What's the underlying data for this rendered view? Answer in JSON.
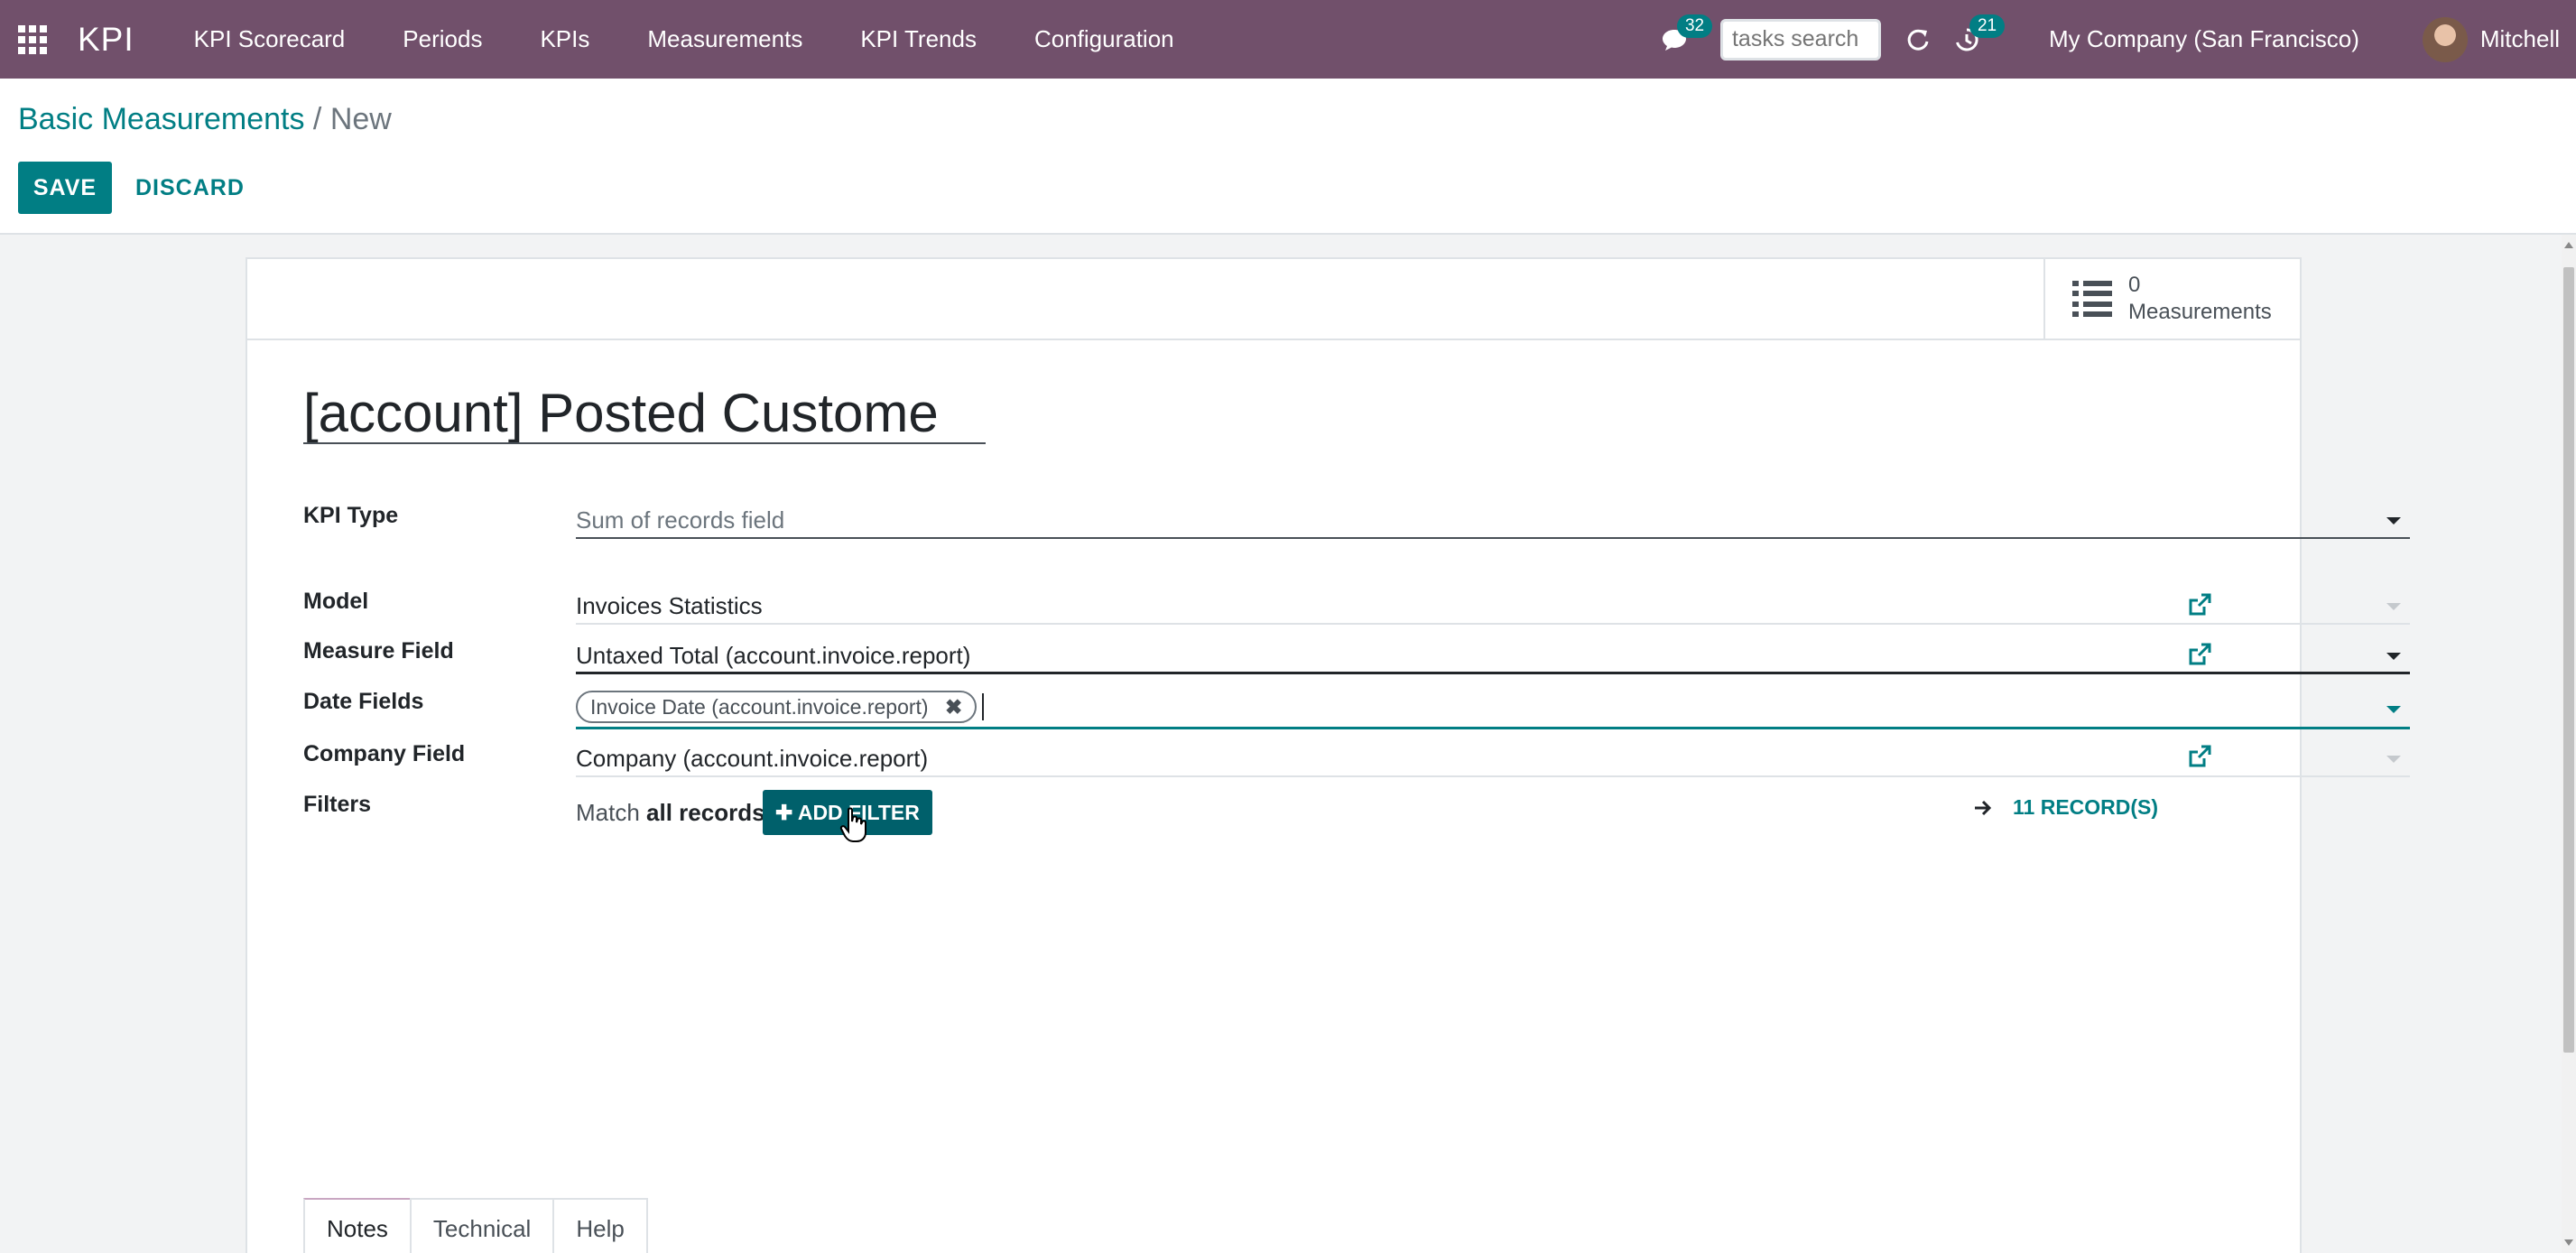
{
  "navbar": {
    "brand": "KPI",
    "menu": [
      "KPI Scorecard",
      "Periods",
      "KPIs",
      "Measurements",
      "KPI Trends",
      "Configuration"
    ],
    "messages_count": "32",
    "search_placeholder": "tasks search",
    "activities_count": "21",
    "company": "My Company (San Francisco)",
    "user": "Mitchell",
    "icons": [
      "apps-grid-icon",
      "chat-icon",
      "refresh-icon",
      "clock-icon",
      "avatar"
    ]
  },
  "breadcrumb": {
    "parent": "Basic Measurements",
    "separator": "/",
    "current": "New"
  },
  "actions": {
    "save": "SAVE",
    "discard": "DISCARD"
  },
  "stat_button": {
    "count": "0",
    "label": "Measurements"
  },
  "form": {
    "title": "[account] Posted Custome",
    "fields": {
      "kpi_type": {
        "label": "KPI Type",
        "value": "Sum of records field"
      },
      "model": {
        "label": "Model",
        "value": "Invoices Statistics"
      },
      "measure_field": {
        "label": "Measure Field",
        "value": "Untaxed Total (account.invoice.report)"
      },
      "date_fields": {
        "label": "Date Fields",
        "tags": [
          "Invoice Date (account.invoice.report)"
        ]
      },
      "company_field": {
        "label": "Company Field",
        "value": "Company (account.invoice.report)"
      },
      "filters": {
        "label": "Filters",
        "match_prefix": "Match",
        "match_value": "all records",
        "add_filter": "ADD FILTER",
        "records": "11 RECORD(S)"
      }
    }
  },
  "tabs": [
    "Notes",
    "Technical",
    "Help"
  ],
  "colors": {
    "navbar": "#71506b",
    "primary": "#017e84",
    "add_filter": "#00606b"
  }
}
